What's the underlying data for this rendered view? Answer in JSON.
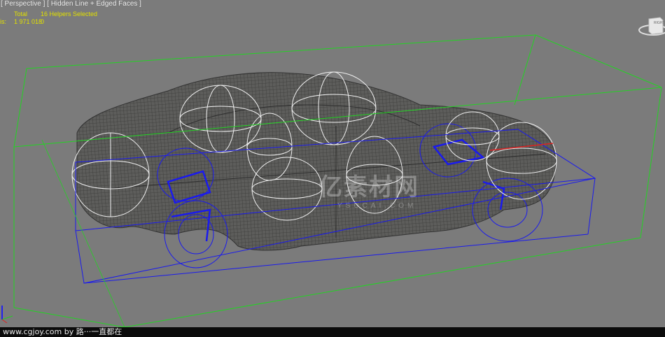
{
  "viewport": {
    "label": "[ Perspective ] [ Hidden Line + Edged Faces ]",
    "stats": {
      "row_label": "is:",
      "total_header": "Total",
      "selection_header": "16 Helpers Selected",
      "total_value": "1 971 018",
      "selection_value": "0"
    },
    "viewcube_label": "RIGHT",
    "watermark_text": "亿素材网",
    "watermark_sub": "YSUCAI.COM"
  },
  "footer": {
    "credit": "www.cgjoy.com by 路···一直都在"
  },
  "colors": {
    "background": "#7b7b7b",
    "bounding_box": "#22d422",
    "helpers": "#1a1aee",
    "dummies": "#f0f0f0",
    "stats_text": "#e1e000"
  }
}
